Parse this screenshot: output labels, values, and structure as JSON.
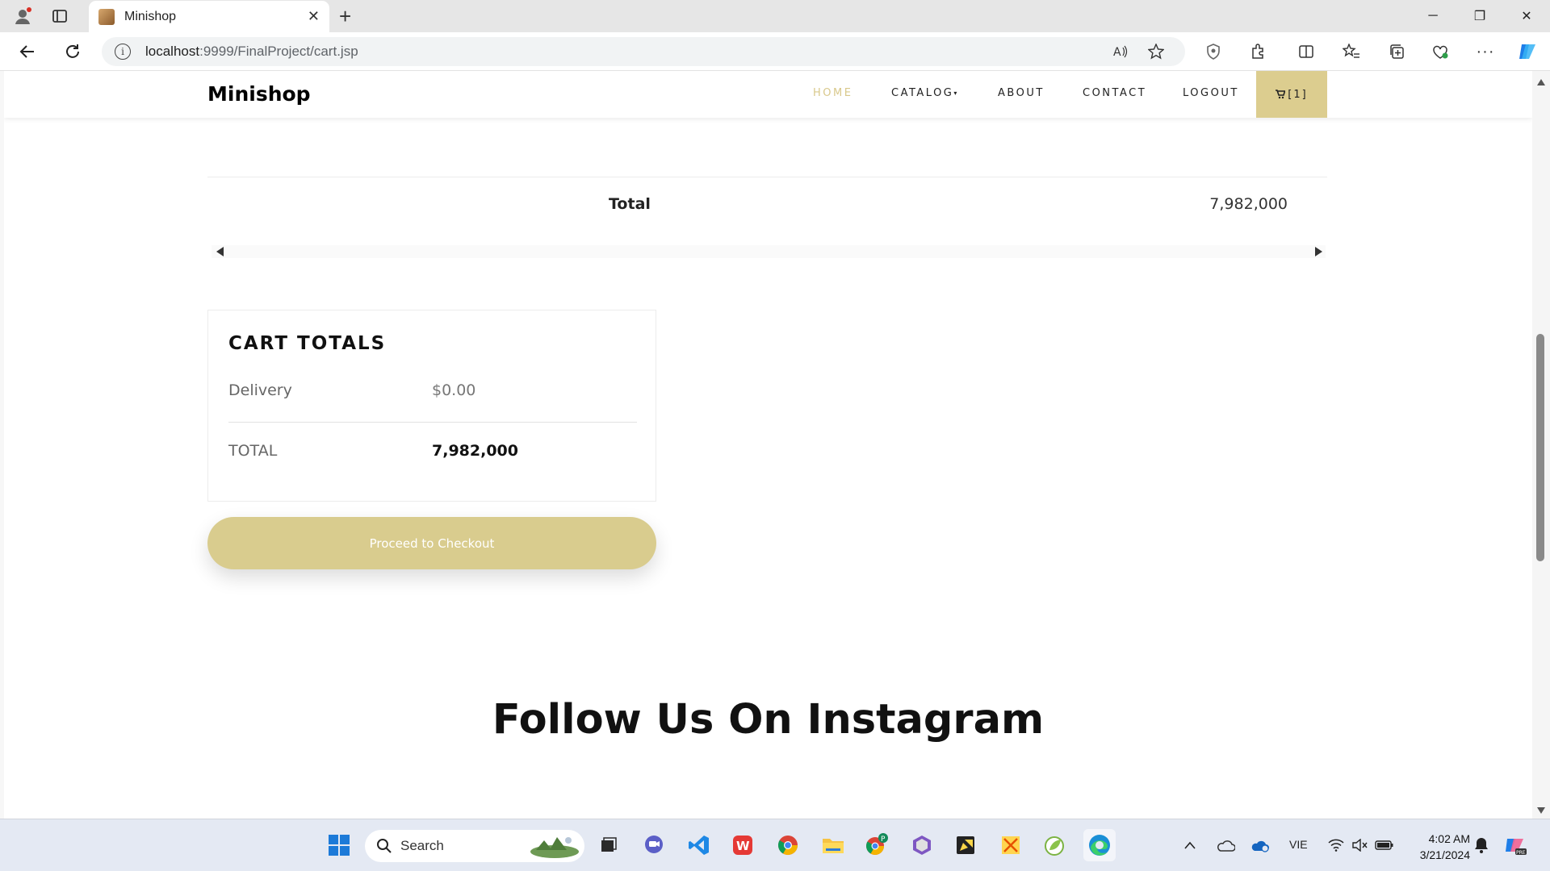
{
  "browser": {
    "tab_title": "Minishop",
    "address_host": "localhost",
    "address_path": ":9999/FinalProject/cart.jsp"
  },
  "navbar": {
    "brand": "Minishop",
    "links": [
      {
        "label": "HOME"
      },
      {
        "label": "CATALOG"
      },
      {
        "label": "ABOUT"
      },
      {
        "label": "CONTACT"
      },
      {
        "label": "LOGOUT"
      }
    ],
    "cart_label": "[1]"
  },
  "cart_table": {
    "total_label": "Total",
    "total_value": "7,982,000"
  },
  "cart_totals": {
    "title": "CART TOTALS",
    "delivery_label": "Delivery",
    "delivery_value": "$0.00",
    "total_label": "TOTAL",
    "total_value": "7,982,000"
  },
  "checkout_button": "Proceed to Checkout",
  "instagram_heading": "Follow Us On Instagram",
  "taskbar": {
    "search_placeholder": "Search",
    "language": "VIE",
    "time": "4:02 AM",
    "date": "3/21/2024"
  },
  "colors": {
    "accent": "#dccd8f",
    "nav_active": "#d9c88b"
  }
}
